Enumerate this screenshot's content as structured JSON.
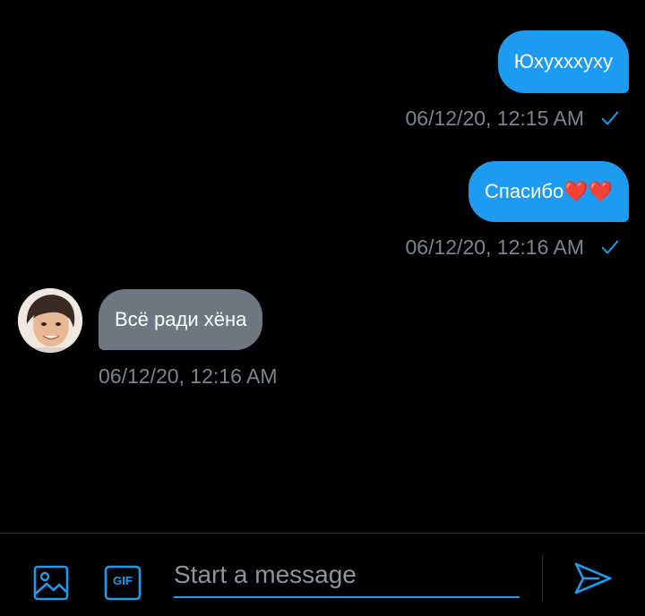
{
  "thread": {
    "messages": [
      {
        "direction": "out",
        "text": "Юхухххуху",
        "timestamp": "06/12/20, 12:15 AM",
        "status_icon": "check-icon"
      },
      {
        "direction": "out",
        "text": "Спасибо❤️❤️",
        "timestamp": "06/12/20, 12:16 AM",
        "status_icon": "check-icon"
      },
      {
        "direction": "in",
        "text": "Всё ради хёна",
        "timestamp": "06/12/20, 12:16 AM",
        "avatar_icon": "avatar-photo"
      }
    ]
  },
  "composer": {
    "media_icon": "image-icon",
    "gif_icon": "gif-icon",
    "gif_label": "GIF",
    "placeholder": "Start a message",
    "value": "",
    "send_icon": "send-icon"
  },
  "colors": {
    "accent": "#1d9bf0",
    "incoming_bubble": "#6e7781",
    "background": "#000000",
    "timestamp": "#7a858f"
  }
}
